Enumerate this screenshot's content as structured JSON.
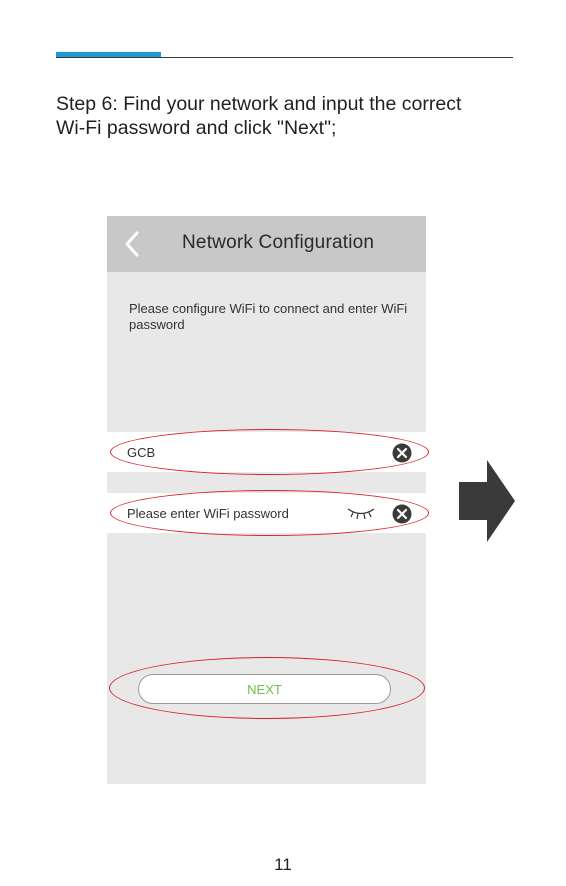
{
  "step": {
    "text_line1": "Step 6: Find your network and input the correct",
    "text_line2": "Wi-Fi password and click \"Next\";"
  },
  "screen": {
    "title": "Network Configuration",
    "instructions": "Please configure WiFi to connect and enter WiFi password",
    "ssid_value": "GCB",
    "password_placeholder": "Please enter WiFi password",
    "next_label": "NEXT"
  },
  "page_number": "11",
  "colors": {
    "accent_bar": "#1f9ad6",
    "highlight_ellipse": "#d8232a",
    "next_text": "#6cc04a",
    "header_bg": "#c8c8c8",
    "screen_bg": "#e8e8e8"
  }
}
